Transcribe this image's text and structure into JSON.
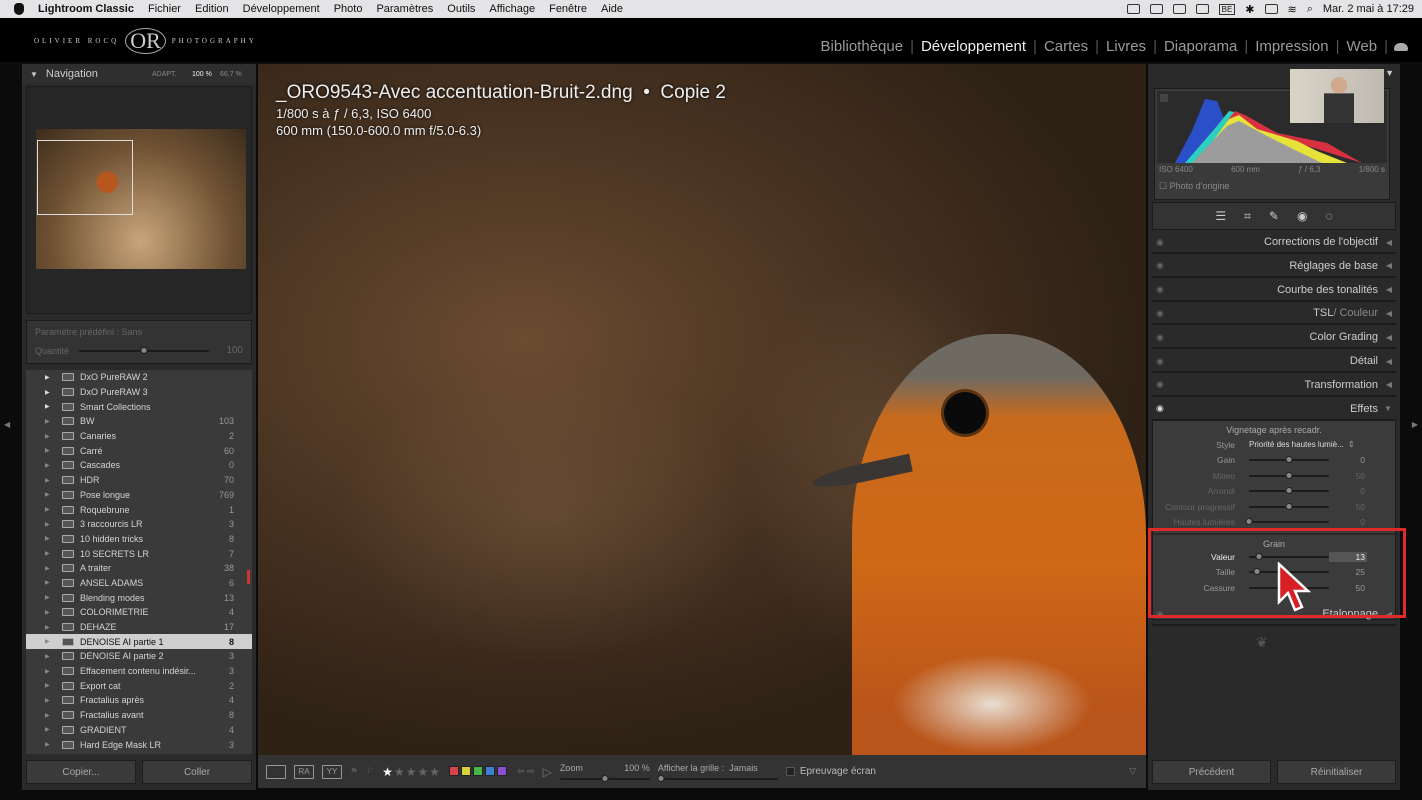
{
  "menubar": {
    "app": "Lightroom Classic",
    "items": [
      "Fichier",
      "Edition",
      "Développement",
      "Photo",
      "Paramètres",
      "Outils",
      "Affichage",
      "Fenêtre",
      "Aide"
    ],
    "clock": "Mar. 2 mai à 17:29",
    "input_badge": "BE"
  },
  "logo": {
    "left": "OLIVIER ROCQ",
    "mark": "OR",
    "right": "PHOTOGRAPHY"
  },
  "modules": [
    {
      "label": "Bibliothèque",
      "active": false
    },
    {
      "label": "Développement",
      "active": true
    },
    {
      "label": "Cartes",
      "active": false
    },
    {
      "label": "Livres",
      "active": false
    },
    {
      "label": "Diaporama",
      "active": false
    },
    {
      "label": "Impression",
      "active": false
    },
    {
      "label": "Web",
      "active": false
    }
  ],
  "navigator": {
    "title": "Navigation",
    "zoom_options": [
      "ADAPT.",
      "100 %",
      "66,7 %"
    ]
  },
  "preset": {
    "label": "Paramètre prédéfini : Sans",
    "amount_label": "Quantité",
    "amount_value": "100"
  },
  "collections": [
    {
      "name": "DxO PureRAW 2",
      "count": "",
      "type": "set"
    },
    {
      "name": "DxO PureRAW 3",
      "count": "",
      "type": "set"
    },
    {
      "name": "Smart Collections",
      "count": "",
      "type": "set"
    },
    {
      "name": "BW",
      "count": "103",
      "type": "smart"
    },
    {
      "name": "Canaries",
      "count": "2",
      "type": "smart"
    },
    {
      "name": "Carré",
      "count": "60",
      "type": "smart"
    },
    {
      "name": "Cascades",
      "count": "0",
      "type": "smart"
    },
    {
      "name": "HDR",
      "count": "70",
      "type": "smart"
    },
    {
      "name": "Pose longue",
      "count": "769",
      "type": "smart"
    },
    {
      "name": "Roquebrune",
      "count": "1",
      "type": "smart"
    },
    {
      "name": "3 raccourcis LR",
      "count": "3",
      "type": "collection"
    },
    {
      "name": "10 hidden tricks",
      "count": "8",
      "type": "collection"
    },
    {
      "name": "10 SECRETS LR",
      "count": "7",
      "type": "collection"
    },
    {
      "name": "A traiter",
      "count": "38",
      "type": "collection"
    },
    {
      "name": "ANSEL ADAMS",
      "count": "6",
      "type": "collection"
    },
    {
      "name": "Blending modes",
      "count": "13",
      "type": "collection"
    },
    {
      "name": "COLORIMETRIE",
      "count": "4",
      "type": "collection"
    },
    {
      "name": "DEHAZE",
      "count": "17",
      "type": "collection"
    },
    {
      "name": "DENOISE AI partie 1",
      "count": "8",
      "type": "collection",
      "selected": true
    },
    {
      "name": "DENOISE AI partie 2",
      "count": "3",
      "type": "collection"
    },
    {
      "name": "Effacement contenu indésir...",
      "count": "3",
      "type": "collection"
    },
    {
      "name": "Export cat",
      "count": "2",
      "type": "collection"
    },
    {
      "name": "Fractalius après",
      "count": "4",
      "type": "collection"
    },
    {
      "name": "Fractalius avant",
      "count": "8",
      "type": "collection"
    },
    {
      "name": "GRADIENT",
      "count": "4",
      "type": "collection"
    },
    {
      "name": "Hard Edge Mask LR",
      "count": "3",
      "type": "collection"
    }
  ],
  "left_buttons": {
    "copy": "Copier...",
    "paste": "Coller"
  },
  "photo": {
    "filename": "_ORO9543-Avec accentuation-Bruit-2.dng",
    "separator": "•",
    "copy": "Copie 2",
    "exposure": "1/800 s à ƒ / 6,3, ISO 6400",
    "lens": "600 mm (150.0-600.0 mm f/5.0-6.3)"
  },
  "histogram": {
    "iso": "ISO 6400",
    "focal": "600 mm",
    "aperture": "ƒ / 6,3",
    "shutter": "1/800 s",
    "original": "Photo d'origine"
  },
  "tool_icons": [
    "sliders-icon",
    "crop-icon",
    "healing-icon",
    "redeye-icon",
    "mask-icon"
  ],
  "sections": [
    {
      "label": "Corrections de l'objectif"
    },
    {
      "label": "Réglages de base"
    },
    {
      "label": "Courbe des tonalités"
    },
    {
      "label": "TSL",
      "label_dim": " / Couleur"
    },
    {
      "label": "Color Grading"
    },
    {
      "label": "Détail"
    },
    {
      "label": "Transformation"
    },
    {
      "label": "Effets"
    }
  ],
  "effects": {
    "vignette_title": "Vignetage après recadr.",
    "style_label": "Style",
    "style_value": "Priorité des hautes lumiè...",
    "vignette_sliders": [
      {
        "label": "Gain",
        "value": "0",
        "pos": 0.5
      },
      {
        "label": "Milieu",
        "value": "50",
        "pos": 0.5
      },
      {
        "label": "Arrondi",
        "value": "0",
        "pos": 0.5
      },
      {
        "label": "Contour progressif",
        "value": "50",
        "pos": 0.5
      },
      {
        "label": "Hautes lumières",
        "value": "0",
        "pos": 0.0
      }
    ],
    "grain_title": "Grain",
    "grain_sliders": [
      {
        "label": "Valeur",
        "value": "13",
        "pos": 0.13
      },
      {
        "label": "Taille",
        "value": "25",
        "pos": 0.1
      },
      {
        "label": "Cassure",
        "value": "50",
        "pos": 0.5
      }
    ]
  },
  "calibration": "Etalonnage",
  "right_buttons": {
    "previous": "Précédent",
    "reset": "Réinitialiser"
  },
  "toolbar": {
    "rating": 1,
    "flag_labels": [
      "RA",
      "YY"
    ],
    "label_colors": [
      "#d9434a",
      "#d8d23a",
      "#49b64a",
      "#3f7fd6",
      "#8b4fd3"
    ],
    "zoom_label": "Zoom",
    "zoom_value": "100 %",
    "grid_label": "Afficher la grille :",
    "grid_value": "Jamais",
    "softproof_label": "Epreuvage écran"
  },
  "colors": {
    "highlight": "#e02a2a"
  }
}
